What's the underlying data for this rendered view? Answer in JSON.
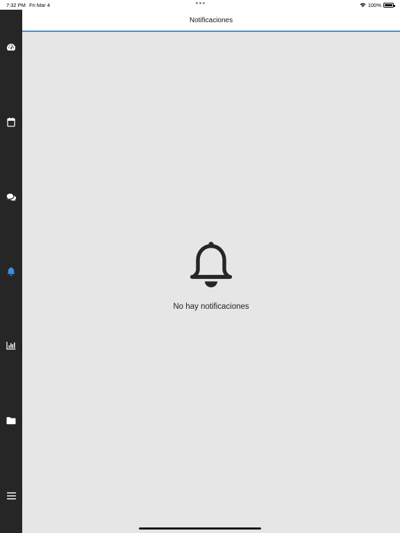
{
  "status_bar": {
    "time": "7:32 PM",
    "date": "Fri Mar 4",
    "battery": "100%"
  },
  "header": {
    "title": "Notificaciones"
  },
  "sidebar": {
    "items": [
      {
        "icon": "dashboard-icon",
        "active": false
      },
      {
        "icon": "calendar-icon",
        "active": false
      },
      {
        "icon": "chat-icon",
        "active": false
      },
      {
        "icon": "bell-icon",
        "active": true
      },
      {
        "icon": "bar-chart-icon",
        "active": false
      },
      {
        "icon": "folder-icon",
        "active": false
      },
      {
        "icon": "menu-icon",
        "active": false
      }
    ]
  },
  "main": {
    "empty_icon": "bell-icon",
    "empty_message": "No hay notificaciones"
  },
  "colors": {
    "sidebar_bg": "#262626",
    "active": "#3d8ee6",
    "content_bg": "#e6e6e6"
  }
}
